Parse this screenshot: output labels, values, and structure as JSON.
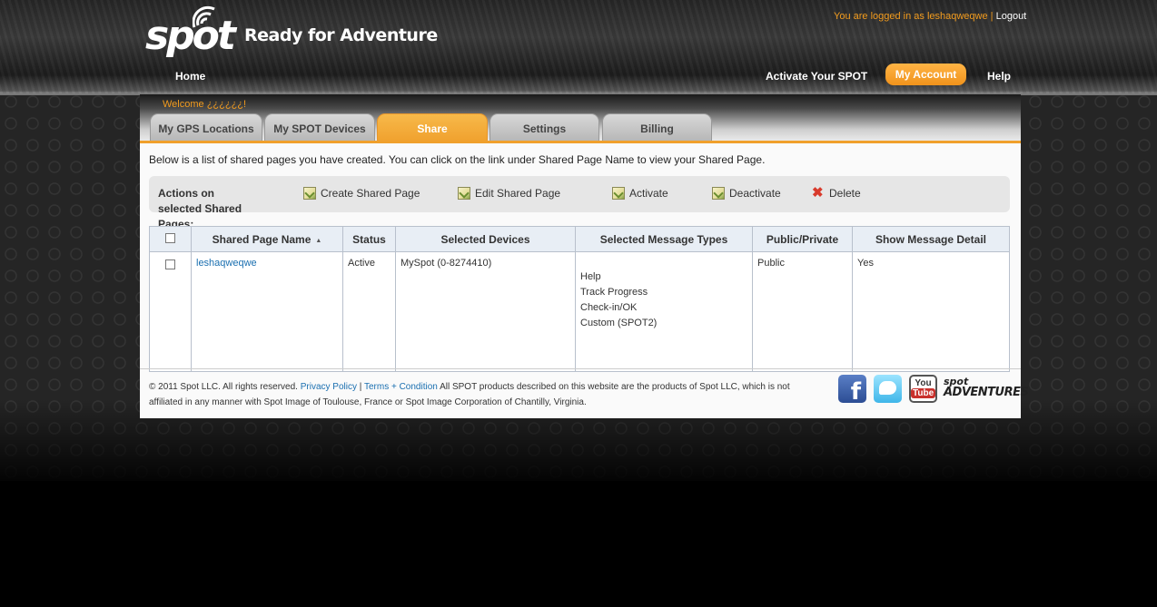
{
  "header": {
    "logo_text": "spot",
    "tagline": "Ready for Adventure",
    "login_prefix": "You are logged in as leshaqweqwe",
    "separator": " | ",
    "logout": "Logout",
    "nav": {
      "home": "Home",
      "activate": "Activate Your SPOT",
      "account": "My Account",
      "help": "Help"
    }
  },
  "welcome": "Welcome ¿¿¿¿¿¿!",
  "tabs": [
    {
      "label": "My GPS Locations",
      "active": false
    },
    {
      "label": "My SPOT Devices",
      "active": false
    },
    {
      "label": "Share",
      "active": true
    },
    {
      "label": "Settings",
      "active": false
    },
    {
      "label": "Billing",
      "active": false
    }
  ],
  "intro": "Below is a list of shared pages you have created. You can click on the link under Shared Page Name to view your Shared Page.",
  "actions": {
    "title": "Actions on selected Shared Pages:",
    "create": "Create Shared Page",
    "edit": "Edit Shared Page",
    "activate": "Activate",
    "deactivate": "Deactivate",
    "delete": "Delete"
  },
  "table": {
    "headers": [
      "Shared Page Name",
      "Status",
      "Selected Devices",
      "Selected Message Types",
      "Public/Private",
      "Show Message Detail"
    ],
    "rows": [
      {
        "name": "leshaqweqwe",
        "status": "Active",
        "devices": "MySpot (0-8274410)",
        "message_types": [
          "Help",
          "Track Progress",
          "Check-in/OK",
          "Custom (SPOT2)"
        ],
        "visibility": "Public",
        "show_detail": "Yes"
      }
    ]
  },
  "footer": {
    "copyright": "© 2011 Spot LLC. All rights reserved.",
    "privacy": "Privacy Policy",
    "sep": "|",
    "terms": "Terms + Condition",
    "disclaimer": "All SPOT products described on this website are the products of Spot LLC, which is not affiliated in any manner with Spot Image of Toulouse, France or Spot Image Corporation of Chantilly, Virginia.",
    "social": {
      "facebook": "f",
      "youtube_you": "You",
      "youtube_tube": "Tube",
      "adventures_top": "spot",
      "adventures_bottom": "ADVENTURES"
    }
  },
  "colors": {
    "accent": "#f0a02c",
    "link": "#1a6fb0"
  }
}
